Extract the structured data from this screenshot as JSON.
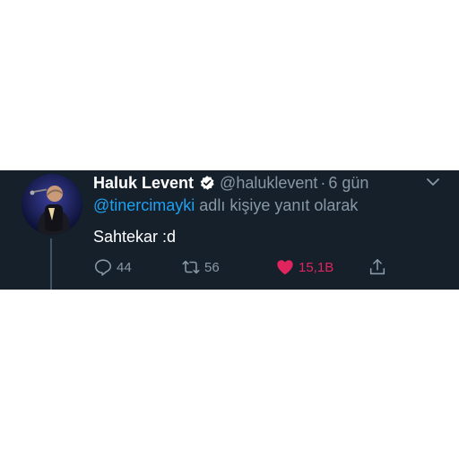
{
  "tweet": {
    "display_name": "Haluk Levent",
    "handle": "@haluklevent",
    "separator": "·",
    "time": "6 gün",
    "reply_to": "@tinercimayki",
    "reply_suffix": " adlı kişiye yanıt olarak",
    "text": "Sahtekar :d",
    "replies": "44",
    "retweets": "56",
    "likes": "15,1B",
    "liked": true
  },
  "colors": {
    "background": "#15202b",
    "text": "#ffffff",
    "secondary": "#8899a6",
    "accent": "#1da1f2",
    "like": "#e0245e"
  },
  "icons": {
    "verified": "verified-badge-icon",
    "more": "chevron-down-icon",
    "reply": "reply-icon",
    "retweet": "retweet-icon",
    "like": "heart-icon",
    "share": "share-icon"
  }
}
